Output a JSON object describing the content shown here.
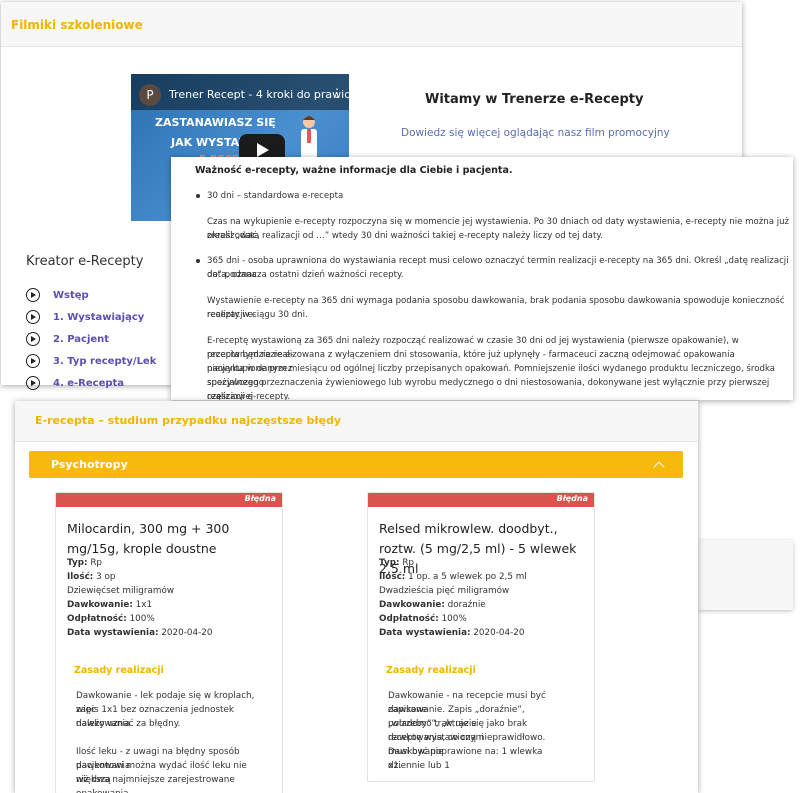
{
  "panel1": {
    "title": "Filmiki szkoleniowe",
    "video": {
      "avatar_letter": "P",
      "title": "Trener Recept - 4 kroki do prawid...",
      "line1": "ZASTANAWIASZ SIĘ",
      "line2": "JAK WYSTAWIĆ",
      "line3": "E-RECEPT"
    },
    "welcome": "Witamy w Trenerze e-Recepty",
    "promo_link": "Dowiedz się więcej oglądając nasz film promocyjny",
    "kreator_title": "Kreator e-Recepty",
    "steps": [
      "Wstęp",
      "1. Wystawiający",
      "2. Pacjent",
      "3. Typ recepty/Lek",
      "4. e-Recepta"
    ]
  },
  "panel2": {
    "title": "Ważność e-recepty, ważne informacje dla Ciebie i pacjenta.",
    "b1": "30 dni – standardowa e-recepta",
    "p1": [
      "Czas na wykupienie e-recepty rozpoczyna się w momencie jej wystawienia. Po 30 dniach od daty wystawienia, e-recepty nie można już zrealizować,",
      "określ „data realizacji od …” wtedy 30 dni ważności takiej e-recepty należy liczy od tej daty."
    ],
    "b2": [
      "365 dni - osoba uprawniona do wystawiania recept musi celowo oznaczyć termin realizacji e-recepty na 365 dni. Określ „datę realizacji do” podana",
      "data, oznacza ostatni dzień ważności recepty."
    ],
    "p2": [
      "Wystawienie e-recepty na 365 dni wymaga podania sposobu dawkowania, brak podania sposobu dawkowania spowoduje konieczność realizacji e-",
      "recepty w ciągu 30 dni."
    ],
    "p3": [
      "E-receptę wystawioną za 365 dni należy rozpocząć realizować w czasie 30 dni od jej wystawienia (pierwsze opakowanie), w przeciwnym razie e-",
      "recepta będzie realizowana z wyłączeniem dni stosowania, które już upłynęły - farmaceuci zaczną odejmować opakowania niewykupione przez",
      "pacjenta w danym miesiącu od ogólnej liczby przepisanych opakowań. Pomniejszenie ilości wydanego produktu leczniczego, środka spożywczego",
      "specjalnego przeznaczenia żywieniowego lub wyrobu medycznego o dni niestosowania, dokonywane jest wyłącznie przy pierwszej częściowej",
      "realizacji e-recepty."
    ]
  },
  "panel3": {
    "title": "E-recepta – studium przypadku najczęstsze błędy",
    "accordion": "Psychotropy",
    "cards": [
      {
        "badge": "Błędna",
        "name": "Milocardin, 300 mg + 300 mg/15g, krople doustne",
        "typ_label": "Typ:",
        "typ": "Rp",
        "ilosc_label": "Ilość:",
        "ilosc": "3 op",
        "ilosc_words": "Dziewięćset miligramów",
        "dawk_label": "Dawkowanie:",
        "dawk": "1x1",
        "odpl_label": "Odpłatność:",
        "odpl": "100%",
        "data_label": "Data wystawienia:",
        "data": "2020-04-20",
        "zasady": "Zasady realizacji",
        "body": [
          "Dawkowanie - lek podaje się w kroplach, więc",
          "zapis 1x1 bez oznaczenia jednostek dawkowania",
          "należy uznać za błędny.",
          "",
          "Ilość leku - z uwagi na błędny sposób dawkowania",
          "pacjentowi można wydać ilość leku nie większą",
          "niż dwa najmniejsze zarejestrowane opakowania."
        ]
      },
      {
        "badge": "Błędna",
        "name": "Relsed mikrowlew. doodbyt., roztw. (5 mg/2,5 ml) - 5 wlewek 2,5 ml",
        "typ_label": "Typ:",
        "typ": "Rp",
        "ilosc_label": "Ilość:",
        "ilosc": "1 op. a 5 wlewek po 2,5 ml",
        "ilosc_words": "Dwadzieścia pięć miligramów",
        "dawk_label": "Dawkowanie:",
        "dawk": "doraźnie",
        "odpl_label": "Odpłatność:",
        "odpl": "100%",
        "data_label": "Data wystawienia:",
        "data": "2020-04-20",
        "zasady": "Zasady realizacji",
        "body": [
          "Dawkowanie - na recepcie musi być zapisane",
          "dawkowanie. Zapis „doraźnie”, „wiadomo”, „w razie",
          "potrzeby” traktuje się jako brak dawkowania, co czyni",
          "receptę wystawioną nieprawidłowo. Dawkowanie",
          "musi być poprawione na: 1 wlewka dziennie lub 1",
          "x1."
        ]
      }
    ]
  }
}
